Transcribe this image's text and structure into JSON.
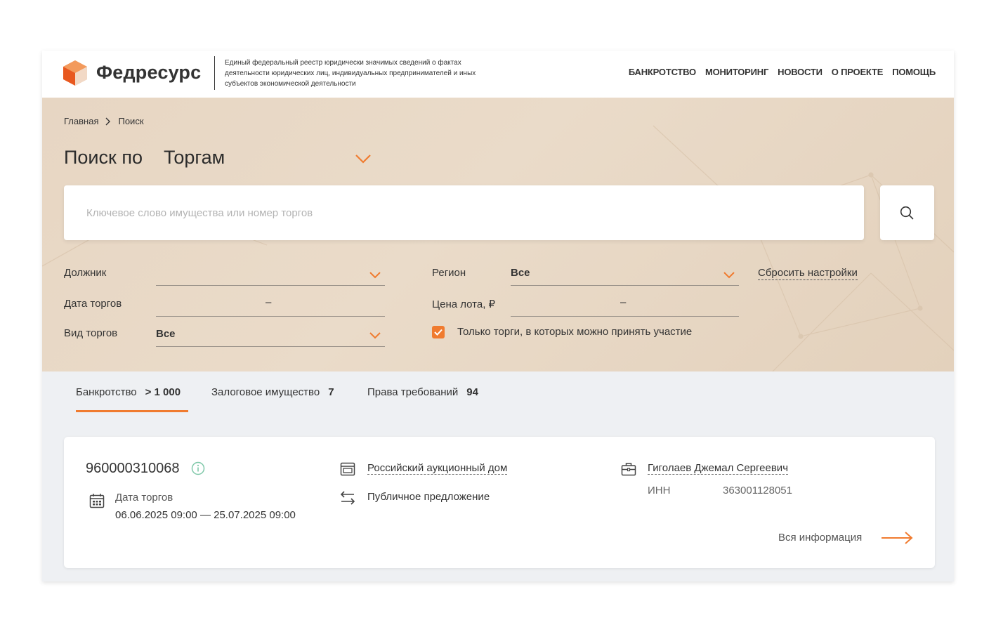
{
  "header": {
    "logo_text": "Федресурс",
    "tagline": "Единый федеральный реестр юридически значимых сведений о фактах деятельности юридических лиц, индивидуальных предпринимателей и иных субъектов экономической деятельности",
    "nav": [
      "БАНКРОТСТВО",
      "МОНИТОРИНГ",
      "НОВОСТИ",
      "О ПРОЕКТЕ",
      "ПОМОЩЬ"
    ]
  },
  "breadcrumb": {
    "home": "Главная",
    "current": "Поиск"
  },
  "search": {
    "title_prefix": "Поиск по",
    "title_selected": "Торгам",
    "placeholder": "Ключевое слово имущества или номер торгов"
  },
  "filters": {
    "debtor_label": "Должник",
    "debtor_value": "",
    "region_label": "Регион",
    "region_value": "Все",
    "reset_label": "Сбросить настройки",
    "date_label": "Дата торгов",
    "price_label": "Цена лота, ₽",
    "range_dash": "–",
    "type_label": "Вид торгов",
    "type_value": "Все",
    "only_open_label": "Только торги, в которых можно принять участие",
    "only_open_checked": true
  },
  "tabs": [
    {
      "label": "Банкротство",
      "count": "> 1 000",
      "active": true
    },
    {
      "label": "Залоговое имущество",
      "count": "7",
      "active": false
    },
    {
      "label": "Права требований",
      "count": "94",
      "active": false
    }
  ],
  "result": {
    "lot_number": "960000310068",
    "date_label": "Дата торгов",
    "date_value": "06.06.2025 09:00 — 25.07.2025 09:00",
    "organizer": "Российский аукционный дом",
    "trade_type": "Публичное предложение",
    "debtor": "Гиголаев Джемал Сергеевич",
    "inn_label": "ИНН",
    "inn_value": "363001128051",
    "all_info_label": "Вся информация"
  },
  "colors": {
    "accent": "#f07b2f",
    "hero_bg": "#e7d6c3",
    "page_bg": "#eef0f3",
    "info_icon": "#7fc8a9"
  },
  "icons": [
    "logo-mark-icon",
    "chevron-down-icon",
    "search-icon",
    "check-icon",
    "info-icon",
    "calendar-icon",
    "building-icon",
    "swap-arrows-icon",
    "briefcase-icon",
    "arrow-right-icon",
    "breadcrumb-chevron-icon"
  ]
}
